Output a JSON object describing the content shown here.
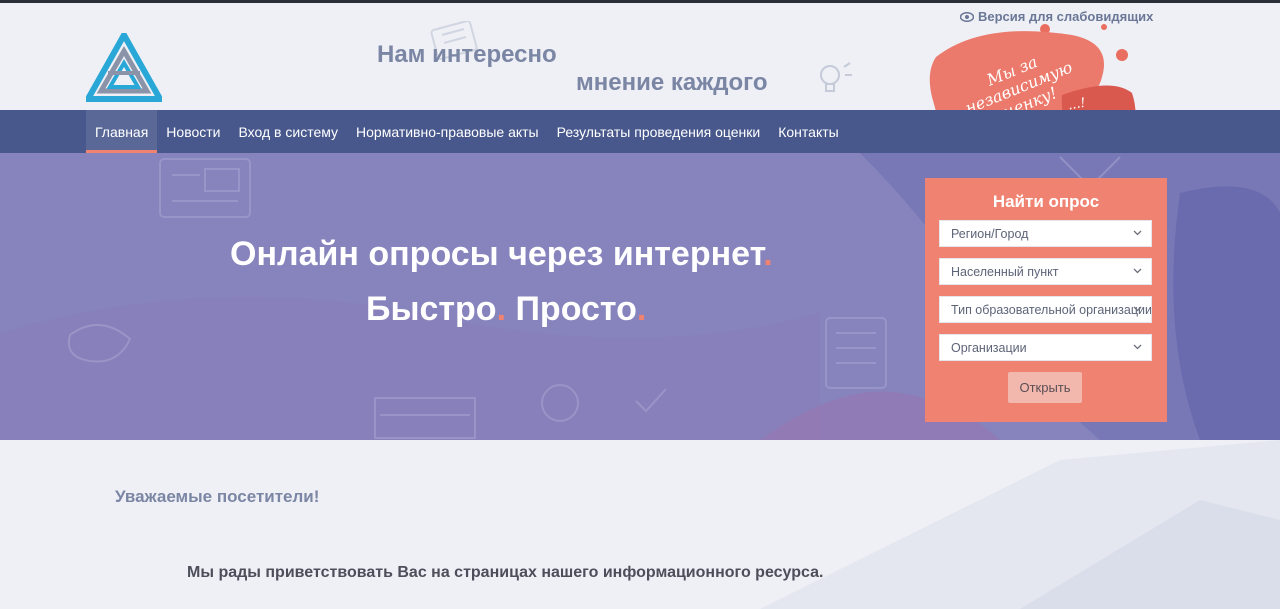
{
  "header": {
    "tagline_line1": "Нам интересно",
    "tagline_line2": "мнение каждого",
    "accessibility_link": "Версия для слабовидящих",
    "badge_text": "Мы за независимую оценку!",
    "badge_text2": "...!"
  },
  "nav": {
    "items": [
      {
        "label": "Главная",
        "active": true
      },
      {
        "label": "Новости"
      },
      {
        "label": "Вход в систему"
      },
      {
        "label": "Нормативно-правовые акты"
      },
      {
        "label": "Результаты проведения оценки"
      },
      {
        "label": "Контакты"
      }
    ]
  },
  "hero": {
    "title": "Онлайн опросы через интернет",
    "sub_word1": "Быстро",
    "sub_word2": "Просто",
    "dot": "."
  },
  "search": {
    "title": "Найти опрос",
    "region": "Регион/Город",
    "locality": "Населенный пункт",
    "org_type": "Тип образовательной организации",
    "organizations": "Организации",
    "open_button": "Открыть"
  },
  "content": {
    "greeting": "Уважаемые посетители!",
    "welcome": "Мы рады приветствовать Вас на страницах нашего информационного ресурса."
  },
  "colors": {
    "nav": "#48588c",
    "hero": "#8683bd",
    "accent": "#f08272",
    "logo_blue": "#29a7d6"
  }
}
